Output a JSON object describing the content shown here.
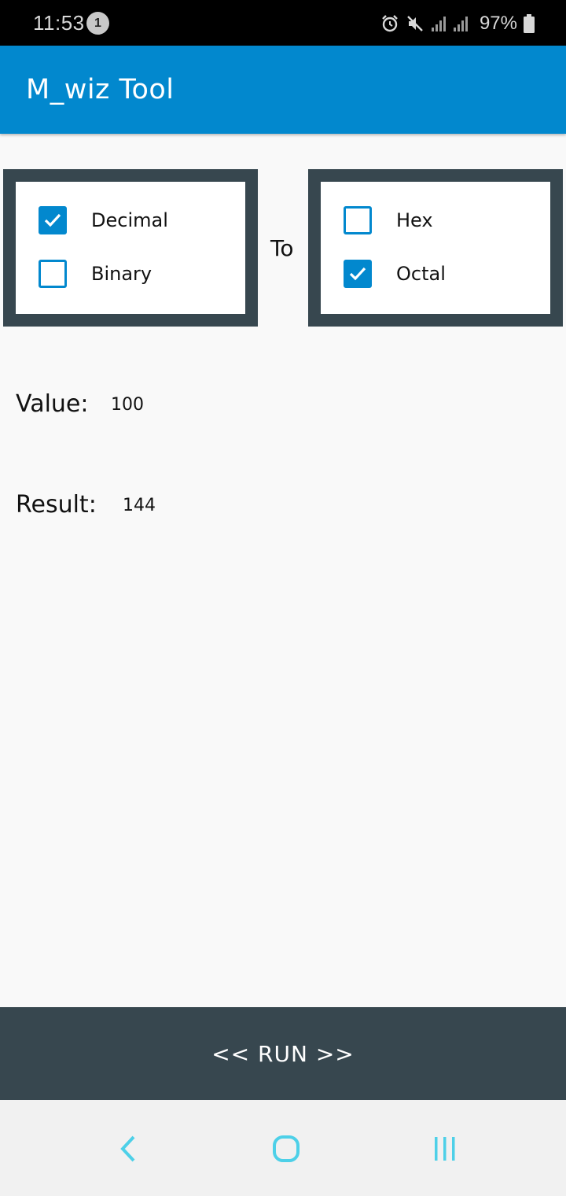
{
  "status_bar": {
    "time": "11:53",
    "notification_count": "1",
    "battery_percent": "97%",
    "icons": [
      "alarm-icon",
      "mute-icon",
      "signal-icon",
      "signal-icon",
      "battery-icon"
    ]
  },
  "app_bar": {
    "title": "M_wiz Tool"
  },
  "from_options": [
    {
      "label": "Decimal",
      "checked": true
    },
    {
      "label": "Binary",
      "checked": false
    }
  ],
  "to_label": "To",
  "to_options": [
    {
      "label": "Hex",
      "checked": false
    },
    {
      "label": "Octal",
      "checked": true
    }
  ],
  "value_row": {
    "label": "Value:",
    "value": "100"
  },
  "result_row": {
    "label": "Result:",
    "value": "144"
  },
  "run_button": {
    "label": "<< RUN >>"
  },
  "colors": {
    "accent": "#0288ce",
    "panel_border": "#37474f",
    "nav_icon": "#4dd0e8"
  }
}
